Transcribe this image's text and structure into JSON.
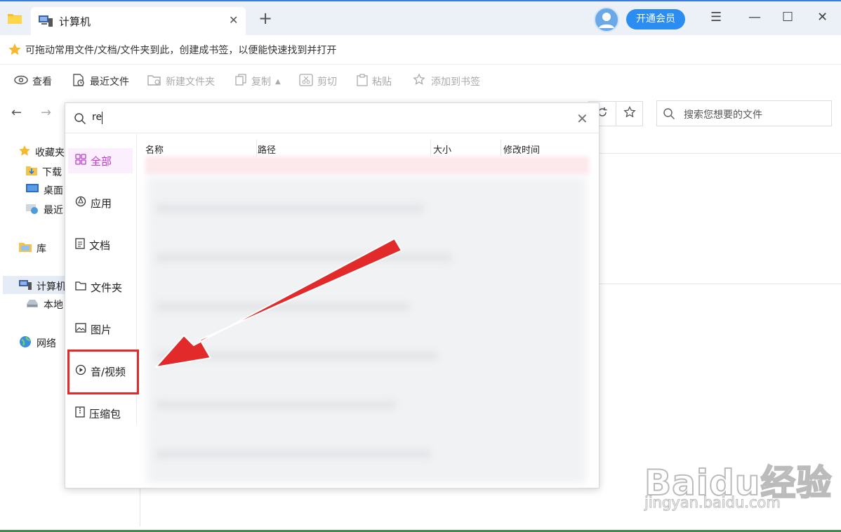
{
  "window": {
    "tab_title": "计算机",
    "new_tab": "+",
    "vip_button": "开通会员",
    "menu_icon": "☰",
    "minimize_icon": "—",
    "maximize_icon": "☐",
    "close_icon": "✕",
    "tab_close_icon": "✕"
  },
  "bookmark_bar": {
    "hint": "可拖动常用文件/文档/文件夹到此，创建成书签，以便能快速找到并打开"
  },
  "toolbar": {
    "view": "查看",
    "recent": "最近文件",
    "new_folder": "新建文件夹",
    "copy": "复制",
    "cut": "剪切",
    "paste": "粘贴",
    "bookmark": "添加到书签"
  },
  "nav": {
    "favorites": "收藏夹",
    "downloads": "下载",
    "desktop": "桌面",
    "recent": "最近",
    "library": "库",
    "computer": "计算机",
    "local_disk": "本地",
    "network": "网络"
  },
  "search": {
    "placeholder": "搜索您想要的文件"
  },
  "popup": {
    "query": "re",
    "categories": [
      {
        "label": "全部",
        "icon": "grid-icon"
      },
      {
        "label": "应用",
        "icon": "app-icon"
      },
      {
        "label": "文档",
        "icon": "document-icon"
      },
      {
        "label": "文件夹",
        "icon": "folder-icon"
      },
      {
        "label": "图片",
        "icon": "image-icon"
      },
      {
        "label": "音/视频",
        "icon": "play-icon"
      },
      {
        "label": "压缩包",
        "icon": "zip-icon"
      }
    ],
    "columns": [
      "名称",
      "路径",
      "大小",
      "修改时间"
    ]
  },
  "watermark": {
    "logo": "Baidu经验",
    "url": "jingyan.baidu.com"
  },
  "colors": {
    "accent": "#2b8cf2",
    "selected_category": "#c23ad0",
    "annotation": "#e32a2a"
  }
}
